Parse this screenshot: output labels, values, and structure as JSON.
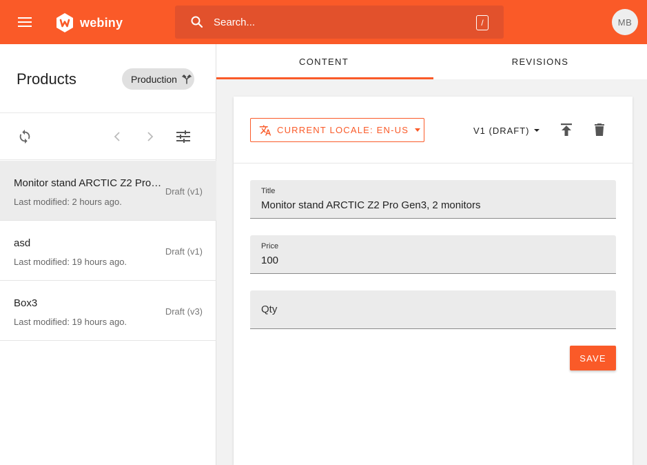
{
  "app": {
    "logo_text": "webiny",
    "search": {
      "placeholder": "Search...",
      "shortcut": "/"
    },
    "user_initials": "MB",
    "colors": {
      "brand": "#fa5a28",
      "search_bg": "#e2512c"
    }
  },
  "sidebar": {
    "title": "Products",
    "environment": "Production",
    "icons": [
      "refresh-icon",
      "chevron-left-icon",
      "chevron-right-icon",
      "filter-sliders-icon"
    ],
    "items": [
      {
        "title": "Monitor stand ARCTIC Z2 Pro Gen3, 2 monitors",
        "modified": "Last modified: 2 hours ago.",
        "status": "Draft (v1)"
      },
      {
        "title": "asd",
        "modified": "Last modified: 19 hours ago.",
        "status": "Draft (v1)"
      },
      {
        "title": "Box3",
        "modified": "Last modified: 19 hours ago.",
        "status": "Draft (v3)"
      }
    ]
  },
  "tabs": [
    {
      "label": "CONTENT",
      "active": true
    },
    {
      "label": "REVISIONS",
      "active": false
    }
  ],
  "editor": {
    "locale_label": "CURRENT LOCALE: EN-US",
    "version_label": "V1 (DRAFT)",
    "fields": [
      {
        "label": "Title",
        "value": "Monitor stand ARCTIC Z2 Pro Gen3, 2 monitors"
      },
      {
        "label": "Price",
        "value": "100"
      },
      {
        "label": "Qty",
        "value": ""
      }
    ],
    "save_label": "SAVE"
  }
}
